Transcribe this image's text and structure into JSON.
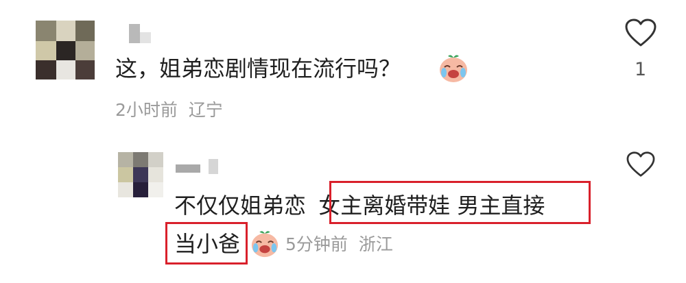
{
  "comment": {
    "text": "这，姐弟恋剧情现在流行吗？",
    "time": "2小时前",
    "location": "辽宁",
    "like_count": "1"
  },
  "reply": {
    "text_start": "不仅仅姐弟恋 ",
    "text_highlight": "女主离婚带娃 男主直接",
    "text_highlight_2": "当小爸",
    "time": "5分钟前",
    "location": "浙江"
  },
  "icons": {
    "emoji": "laughing-crying-face-emoji",
    "like": "heart-outline-icon"
  },
  "colors": {
    "highlight_border": "#d9202b",
    "meta_text": "#9a9a9a"
  }
}
